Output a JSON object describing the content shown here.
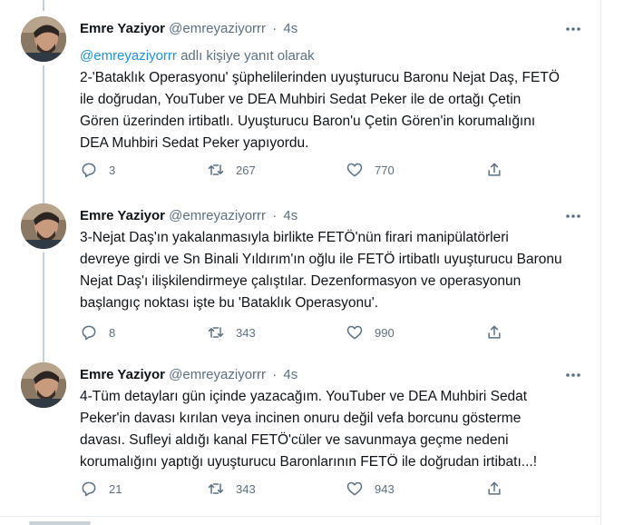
{
  "colors": {
    "text": "#0f1419",
    "secondary": "#5b7083",
    "link": "#1b95e0",
    "divider": "#e6ecf0",
    "thread_line": "#c4cfd6"
  },
  "tweets": [
    {
      "name": "Emre Yaziyor",
      "handle": "@emreyaziyorrr",
      "separator": "·",
      "time": "4s",
      "reply_to": {
        "mention": "@emreyaziyorrr",
        "suffix": " adlı kişiye yanıt olarak"
      },
      "lines": [
        "2-'Bataklık Operasyonu' şüphelilerinden uyuşturucu Baronu Nejat Daş, FETÖ",
        "ile doğrudan, YouTuber ve DEA Muhbiri Sedat Peker ile de ortağı Çetin",
        "Gören üzerinden irtibatlı. Uyuşturucu Baron'u Çetin Gören'in korumalığını",
        "DEA Muhbiri Sedat Peker yapıyordu."
      ],
      "replies": "3",
      "retweets": "267",
      "likes": "770"
    },
    {
      "name": "Emre Yaziyor",
      "handle": "@emreyaziyorrr",
      "separator": "·",
      "time": "4s",
      "lines": [
        "3-Nejat Daş'ın yakalanmasıyla birlikte FETÖ'nün firari manipülatörleri",
        "devreye girdi ve Sn Binali Yıldırım'ın oğlu ile FETÖ irtibatlı uyuşturucu Baronu",
        "Nejat Daş'ı ilişkilendirmeye çalıştılar. Dezenformasyon ve operasyonun",
        "başlangıç noktası işte bu 'Bataklık Operasyonu'."
      ],
      "replies": "8",
      "retweets": "343",
      "likes": "990"
    },
    {
      "name": "Emre Yaziyor",
      "handle": "@emreyaziyorrr",
      "separator": "·",
      "time": "4s",
      "lines": [
        "4-Tüm detayları gün içinde yazacağım. YouTuber ve DEA Muhbiri Sedat",
        "Peker'in davası kırılan veya incinen onuru değil vefa borcunu gösterme",
        "davası. Sufleyi aldığı kanal FETÖ'cüler ve savunmaya geçme nedeni",
        "korumalığını yaptığı uyuşturucu Baronlarının FETÖ ile doğrudan irtibatı...!"
      ],
      "replies": "21",
      "retweets": "343",
      "likes": "943"
    }
  ]
}
